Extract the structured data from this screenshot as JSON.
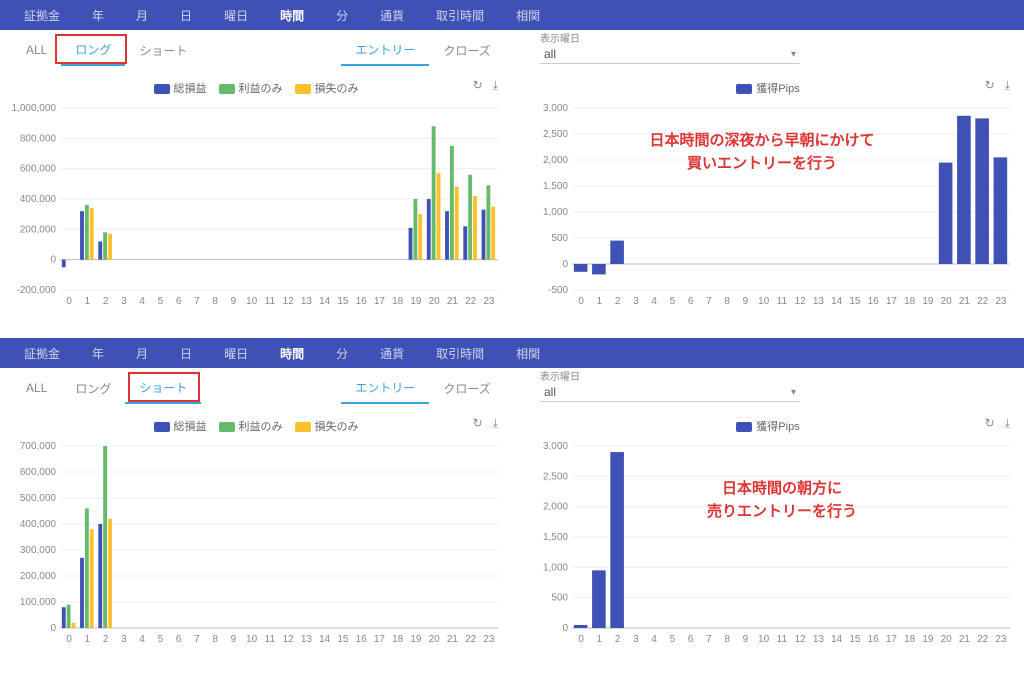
{
  "nav": {
    "items": [
      "証拠金",
      "年",
      "月",
      "日",
      "曜日",
      "時間",
      "分",
      "通貨",
      "取引時間",
      "相関"
    ],
    "activeIndex": 5
  },
  "panel1": {
    "subtabs1": {
      "items": [
        "ALL",
        "ロング",
        "ショート"
      ],
      "activeIndex": 1
    },
    "subtabs2": {
      "items": [
        "エントリー",
        "クローズ"
      ],
      "activeIndex": 0
    },
    "highlightTab": "ロング",
    "dayFilter": {
      "label": "表示曜日",
      "value": "all"
    },
    "chartLeft": {
      "legend": [
        {
          "label": "総損益",
          "color": "#3F51B5"
        },
        {
          "label": "利益のみ",
          "color": "#66BB6A"
        },
        {
          "label": "損失のみ",
          "color": "#FBC02D"
        }
      ]
    },
    "chartRight": {
      "legend": [
        {
          "label": "獲得Pips",
          "color": "#3F51B5"
        }
      ],
      "annotation": "日本時間の深夜から早朝にかけて\n買いエントリーを行う"
    }
  },
  "panel2": {
    "subtabs1": {
      "items": [
        "ALL",
        "ロング",
        "ショート"
      ],
      "activeIndex": 2
    },
    "subtabs2": {
      "items": [
        "エントリー",
        "クローズ"
      ],
      "activeIndex": 0
    },
    "highlightTab": "ショート",
    "dayFilter": {
      "label": "表示曜日",
      "value": "all"
    },
    "chartLeft": {
      "legend": [
        {
          "label": "総損益",
          "color": "#3F51B5"
        },
        {
          "label": "利益のみ",
          "color": "#66BB6A"
        },
        {
          "label": "損失のみ",
          "color": "#FBC02D"
        }
      ]
    },
    "chartRight": {
      "legend": [
        {
          "label": "獲得Pips",
          "color": "#3F51B5"
        }
      ],
      "annotation": "日本時間の朝方に\n売りエントリーを行う"
    }
  },
  "icons": {
    "reload": "↻",
    "download": "⤓",
    "caret": "▾"
  },
  "chart_data": [
    {
      "id": "panel1_left",
      "type": "bar",
      "title": "",
      "categories": [
        0,
        1,
        2,
        3,
        4,
        5,
        6,
        7,
        8,
        9,
        10,
        11,
        12,
        13,
        14,
        15,
        16,
        17,
        18,
        19,
        20,
        21,
        22,
        23
      ],
      "series": [
        {
          "name": "総損益",
          "color": "#3F51B5",
          "values": [
            -50000,
            320000,
            120000,
            0,
            0,
            0,
            0,
            0,
            0,
            0,
            0,
            0,
            0,
            0,
            0,
            0,
            0,
            0,
            0,
            210000,
            400000,
            320000,
            220000,
            330000
          ]
        },
        {
          "name": "利益のみ",
          "color": "#66BB6A",
          "values": [
            0,
            360000,
            180000,
            0,
            0,
            0,
            0,
            0,
            0,
            0,
            0,
            0,
            0,
            0,
            0,
            0,
            0,
            0,
            0,
            400000,
            880000,
            750000,
            560000,
            490000
          ]
        },
        {
          "name": "損失のみ",
          "color": "#FBC02D",
          "values": [
            0,
            340000,
            170000,
            0,
            0,
            0,
            0,
            0,
            0,
            0,
            0,
            0,
            0,
            0,
            0,
            0,
            0,
            0,
            0,
            300000,
            570000,
            480000,
            420000,
            350000
          ]
        }
      ],
      "ylim": [
        -200000,
        1000000
      ],
      "yticks": [
        -200000,
        0,
        200000,
        400000,
        600000,
        800000,
        1000000
      ],
      "xlabel": "",
      "ylabel": ""
    },
    {
      "id": "panel1_right",
      "type": "bar",
      "title": "",
      "categories": [
        0,
        1,
        2,
        3,
        4,
        5,
        6,
        7,
        8,
        9,
        10,
        11,
        12,
        13,
        14,
        15,
        16,
        17,
        18,
        19,
        20,
        21,
        22,
        23
      ],
      "series": [
        {
          "name": "獲得Pips",
          "color": "#3F51B5",
          "values": [
            -150,
            -200,
            450,
            0,
            0,
            0,
            0,
            0,
            0,
            0,
            0,
            0,
            0,
            0,
            0,
            0,
            0,
            0,
            0,
            0,
            1950,
            2850,
            2800,
            2050
          ]
        }
      ],
      "ylim": [
        -500,
        3000
      ],
      "yticks": [
        -500,
        0,
        500,
        1000,
        1500,
        2000,
        2500,
        3000
      ],
      "xlabel": "",
      "ylabel": ""
    },
    {
      "id": "panel2_left",
      "type": "bar",
      "title": "",
      "categories": [
        0,
        1,
        2,
        3,
        4,
        5,
        6,
        7,
        8,
        9,
        10,
        11,
        12,
        13,
        14,
        15,
        16,
        17,
        18,
        19,
        20,
        21,
        22,
        23
      ],
      "series": [
        {
          "name": "総損益",
          "color": "#3F51B5",
          "values": [
            80000,
            270000,
            400000,
            0,
            0,
            0,
            0,
            0,
            0,
            0,
            0,
            0,
            0,
            0,
            0,
            0,
            0,
            0,
            0,
            0,
            0,
            0,
            0,
            0
          ]
        },
        {
          "name": "利益のみ",
          "color": "#66BB6A",
          "values": [
            90000,
            460000,
            700000,
            0,
            0,
            0,
            0,
            0,
            0,
            0,
            0,
            0,
            0,
            0,
            0,
            0,
            0,
            0,
            0,
            0,
            0,
            0,
            0,
            0
          ]
        },
        {
          "name": "損失のみ",
          "color": "#FBC02D",
          "values": [
            20000,
            380000,
            420000,
            0,
            0,
            0,
            0,
            0,
            0,
            0,
            0,
            0,
            0,
            0,
            0,
            0,
            0,
            0,
            0,
            0,
            0,
            0,
            0,
            0
          ]
        }
      ],
      "ylim": [
        0,
        700000
      ],
      "yticks": [
        0,
        100000,
        200000,
        300000,
        400000,
        500000,
        600000,
        700000
      ],
      "xlabel": "",
      "ylabel": ""
    },
    {
      "id": "panel2_right",
      "type": "bar",
      "title": "",
      "categories": [
        0,
        1,
        2,
        3,
        4,
        5,
        6,
        7,
        8,
        9,
        10,
        11,
        12,
        13,
        14,
        15,
        16,
        17,
        18,
        19,
        20,
        21,
        22,
        23
      ],
      "series": [
        {
          "name": "獲得Pips",
          "color": "#3F51B5",
          "values": [
            50,
            950,
            2900,
            0,
            0,
            0,
            0,
            0,
            0,
            0,
            0,
            0,
            0,
            0,
            0,
            0,
            0,
            0,
            0,
            0,
            0,
            0,
            0,
            0
          ]
        }
      ],
      "ylim": [
        0,
        3000
      ],
      "yticks": [
        0,
        500,
        1000,
        1500,
        2000,
        2500,
        3000
      ],
      "xlabel": "",
      "ylabel": ""
    }
  ]
}
